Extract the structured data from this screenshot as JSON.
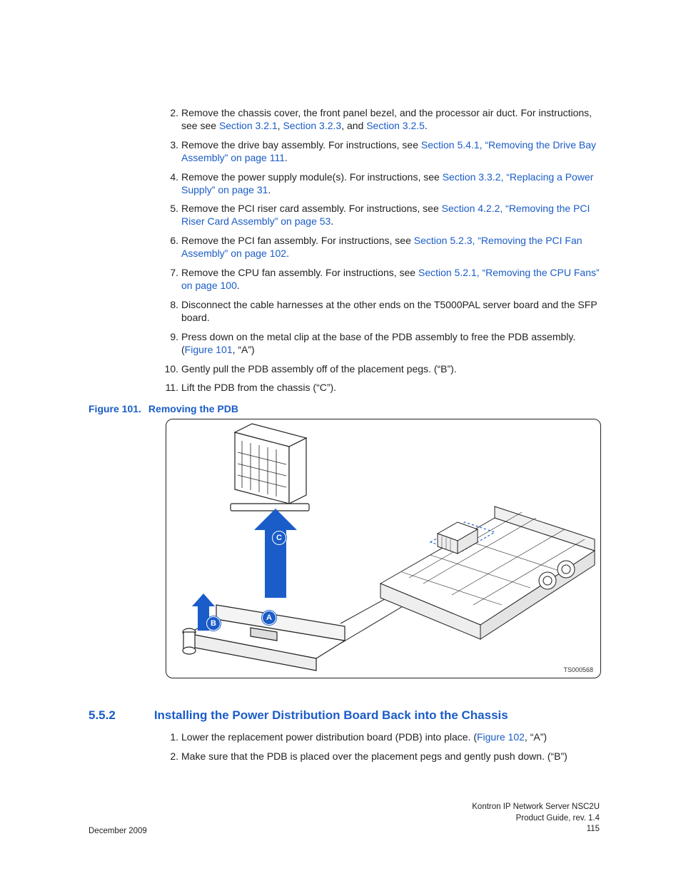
{
  "steps": [
    {
      "n": "2.",
      "pre": "Remove the chassis cover, the front panel bezel, and the processor air duct. For instructions, see see ",
      "links": [
        {
          "t": "Section 3.2.1"
        },
        {
          "t": ", ",
          "plain": true
        },
        {
          "t": "Section 3.2.3"
        },
        {
          "t": ", and ",
          "plain": true
        },
        {
          "t": "Section 3.2.5"
        }
      ],
      "post": "."
    },
    {
      "n": "3.",
      "pre": "Remove the drive bay assembly. For instructions, see ",
      "links": [
        {
          "t": "Section 5.4.1, “Removing the Drive Bay Assembly” on page 111"
        }
      ],
      "post": "."
    },
    {
      "n": "4.",
      "pre": "Remove the power supply module(s). For instructions, see ",
      "links": [
        {
          "t": "Section 3.3.2, “Replacing a Power Supply” on page 31"
        }
      ],
      "post": "."
    },
    {
      "n": "5.",
      "pre": "Remove the PCI riser card assembly. For instructions, see ",
      "links": [
        {
          "t": "Section 4.2.2, “Removing the PCI Riser Card Assembly” on page 53"
        }
      ],
      "post": "."
    },
    {
      "n": "6.",
      "pre": "Remove the PCI fan assembly. For instructions, see ",
      "links": [
        {
          "t": "Section 5.2.3, “Removing the PCI Fan Assembly” on page 102"
        }
      ],
      "post": "."
    },
    {
      "n": "7.",
      "pre": "Remove the CPU fan assembly. For instructions, see ",
      "links": [
        {
          "t": "Section 5.2.1, “Removing the CPU Fans” on page 100"
        }
      ],
      "post": "."
    },
    {
      "n": "8.",
      "pre": "Disconnect the cable harnesses at the other ends on the T5000PAL server board and the SFP board.",
      "links": [],
      "post": ""
    },
    {
      "n": "9.",
      "pre": "Press down on the metal clip at the base of the PDB assembly to free the PDB assembly. (",
      "links": [
        {
          "t": "Figure 101"
        }
      ],
      "post": ", “A”)"
    },
    {
      "n": "10.",
      "pre": " Gently pull the PDB assembly off of the placement pegs.  (“B”).",
      "links": [],
      "post": ""
    },
    {
      "n": "11.",
      "pre": "Lift the PDB from the chassis (“C”).",
      "links": [],
      "post": ""
    }
  ],
  "figure": {
    "label": "Figure 101.",
    "title": "Removing the PDB",
    "id": "TS000568",
    "callouts": {
      "A": "A",
      "B": "B",
      "C": "C"
    }
  },
  "section": {
    "num": "5.5.2",
    "title": "Installing the Power Distribution Board Back into the Chassis"
  },
  "steps2": [
    {
      "n": "1.",
      "pre": "Lower the replacement power distribution board (PDB) into place. (",
      "links": [
        {
          "t": "Figure 102"
        }
      ],
      "post": ", “A”)"
    },
    {
      "n": "2.",
      "pre": "Make sure that the PDB is placed over the placement pegs and gently push down. (“B”)",
      "links": [],
      "post": ""
    }
  ],
  "footer": {
    "date": "December 2009",
    "line1": "Kontron IP Network Server NSC2U",
    "line2": "Product Guide, rev. 1.4",
    "page": "115"
  }
}
